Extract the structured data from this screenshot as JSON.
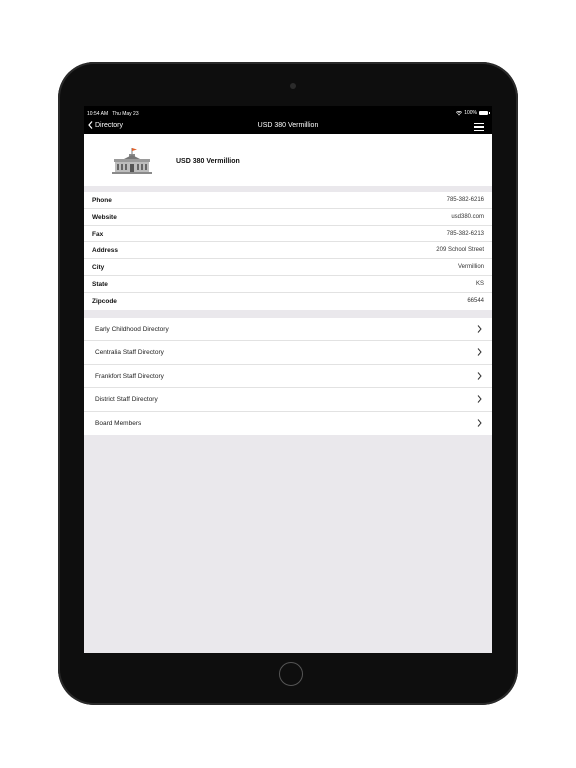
{
  "status": {
    "time": "10:54 AM",
    "date": "Thu May 23",
    "battery": "100%"
  },
  "nav": {
    "back_label": "Directory",
    "title": "USD 380 Vermillion"
  },
  "header": {
    "name": "USD 380 Vermillion",
    "logo_icon": "school-building-icon"
  },
  "info": [
    {
      "label": "Phone",
      "value": "785-382-6216"
    },
    {
      "label": "Website",
      "value": "usd380.com"
    },
    {
      "label": "Fax",
      "value": "785-382-6213"
    },
    {
      "label": "Address",
      "value": "209 School Street"
    },
    {
      "label": "City",
      "value": "Vermillion"
    },
    {
      "label": "State",
      "value": "KS"
    },
    {
      "label": "Zipcode",
      "value": "66544"
    }
  ],
  "directories": [
    {
      "label": "Early Childhood Directory"
    },
    {
      "label": "Centralia Staff Directory"
    },
    {
      "label": "Frankfort Staff Directory"
    },
    {
      "label": "District Staff Directory"
    },
    {
      "label": "Board Members"
    }
  ],
  "colors": {
    "background": "#eae8ec",
    "bezel": "#0e0e0e",
    "flag": "#e0602a"
  }
}
